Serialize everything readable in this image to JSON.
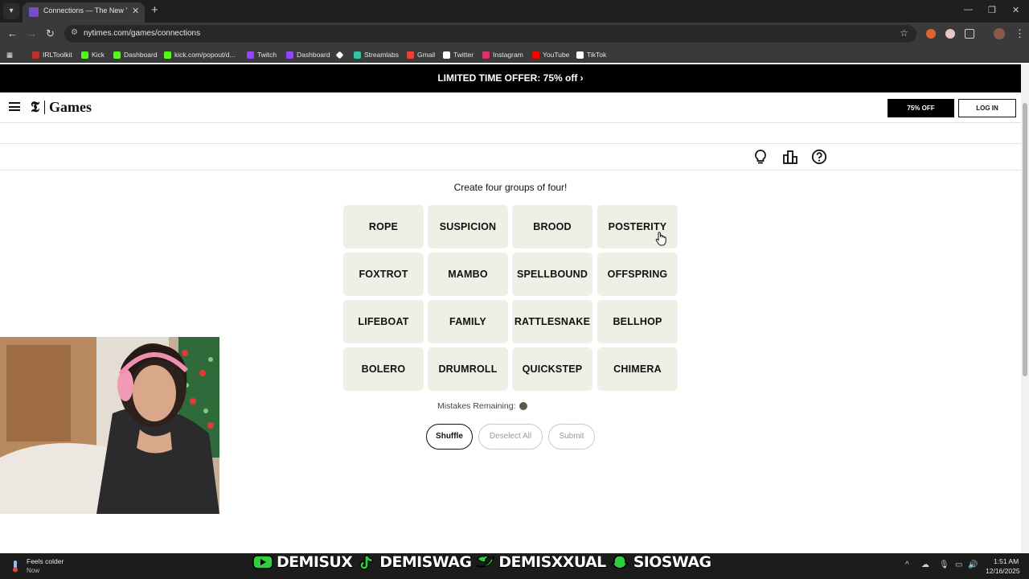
{
  "browser": {
    "tab_title": "Connections — The New York T",
    "tab_close": "✕",
    "new_tab": "+",
    "url": "nytimes.com/games/connections",
    "window_controls": {
      "minimize": "—",
      "maximize": "❐",
      "close": "✕"
    },
    "bookmarks": [
      {
        "label": "IRLToolkit",
        "color": "#c22f2f"
      },
      {
        "label": "Kick",
        "color": "#53fc18"
      },
      {
        "label": "Dashboard",
        "color": "#53fc18"
      },
      {
        "label": "kick.com/popout/d...",
        "color": "#53fc18"
      },
      {
        "label": "Twitch",
        "color": "#9146ff"
      },
      {
        "label": "Dashboard",
        "color": "#9146ff"
      },
      {
        "label": "",
        "color": "#ffffff"
      },
      {
        "label": "Streamlabs",
        "color": "#31c3a2"
      },
      {
        "label": "Gmail",
        "color": "#ea4335"
      },
      {
        "label": "Twitter",
        "color": "#ffffff"
      },
      {
        "label": "Instagram",
        "color": "#e1306c"
      },
      {
        "label": "YouTube",
        "color": "#ff0000"
      },
      {
        "label": "TikTok",
        "color": "#ffffff"
      }
    ]
  },
  "promo": {
    "text": "LIMITED TIME OFFER: 75% off ›"
  },
  "header": {
    "logo_mark": "𝕿",
    "logo_text": "Games",
    "offer_button": "75% OFF",
    "login_button": "LOG IN"
  },
  "game": {
    "prompt": "Create four groups of four!",
    "words": [
      "ROPE",
      "SUSPICION",
      "BROOD",
      "POSTERITY",
      "FOXTROT",
      "MAMBO",
      "SPELLBOUND",
      "OFFSPRING",
      "LIFEBOAT",
      "FAMILY",
      "RATTLESNAKE",
      "BELLHOP",
      "BOLERO",
      "DRUMROLL",
      "QUICKSTEP",
      "CHIMERA"
    ],
    "mistakes_label": "Mistakes Remaining:",
    "mistakes_remaining": 1,
    "buttons": {
      "shuffle": "Shuffle",
      "deselect": "Deselect All",
      "submit": "Submit"
    }
  },
  "taskbar": {
    "weather_title": "Feels colder",
    "weather_sub": "Now",
    "banner_handles": [
      "DEMISUX",
      "DEMISWAG",
      "DEMISXXUAL",
      "SIOSWAG"
    ],
    "time": "1:51 AM",
    "date": "12/16/2025"
  },
  "colors": {
    "card_bg": "#efefe6",
    "mistake_dot": "#5a594e",
    "promo_bg": "#000000"
  }
}
